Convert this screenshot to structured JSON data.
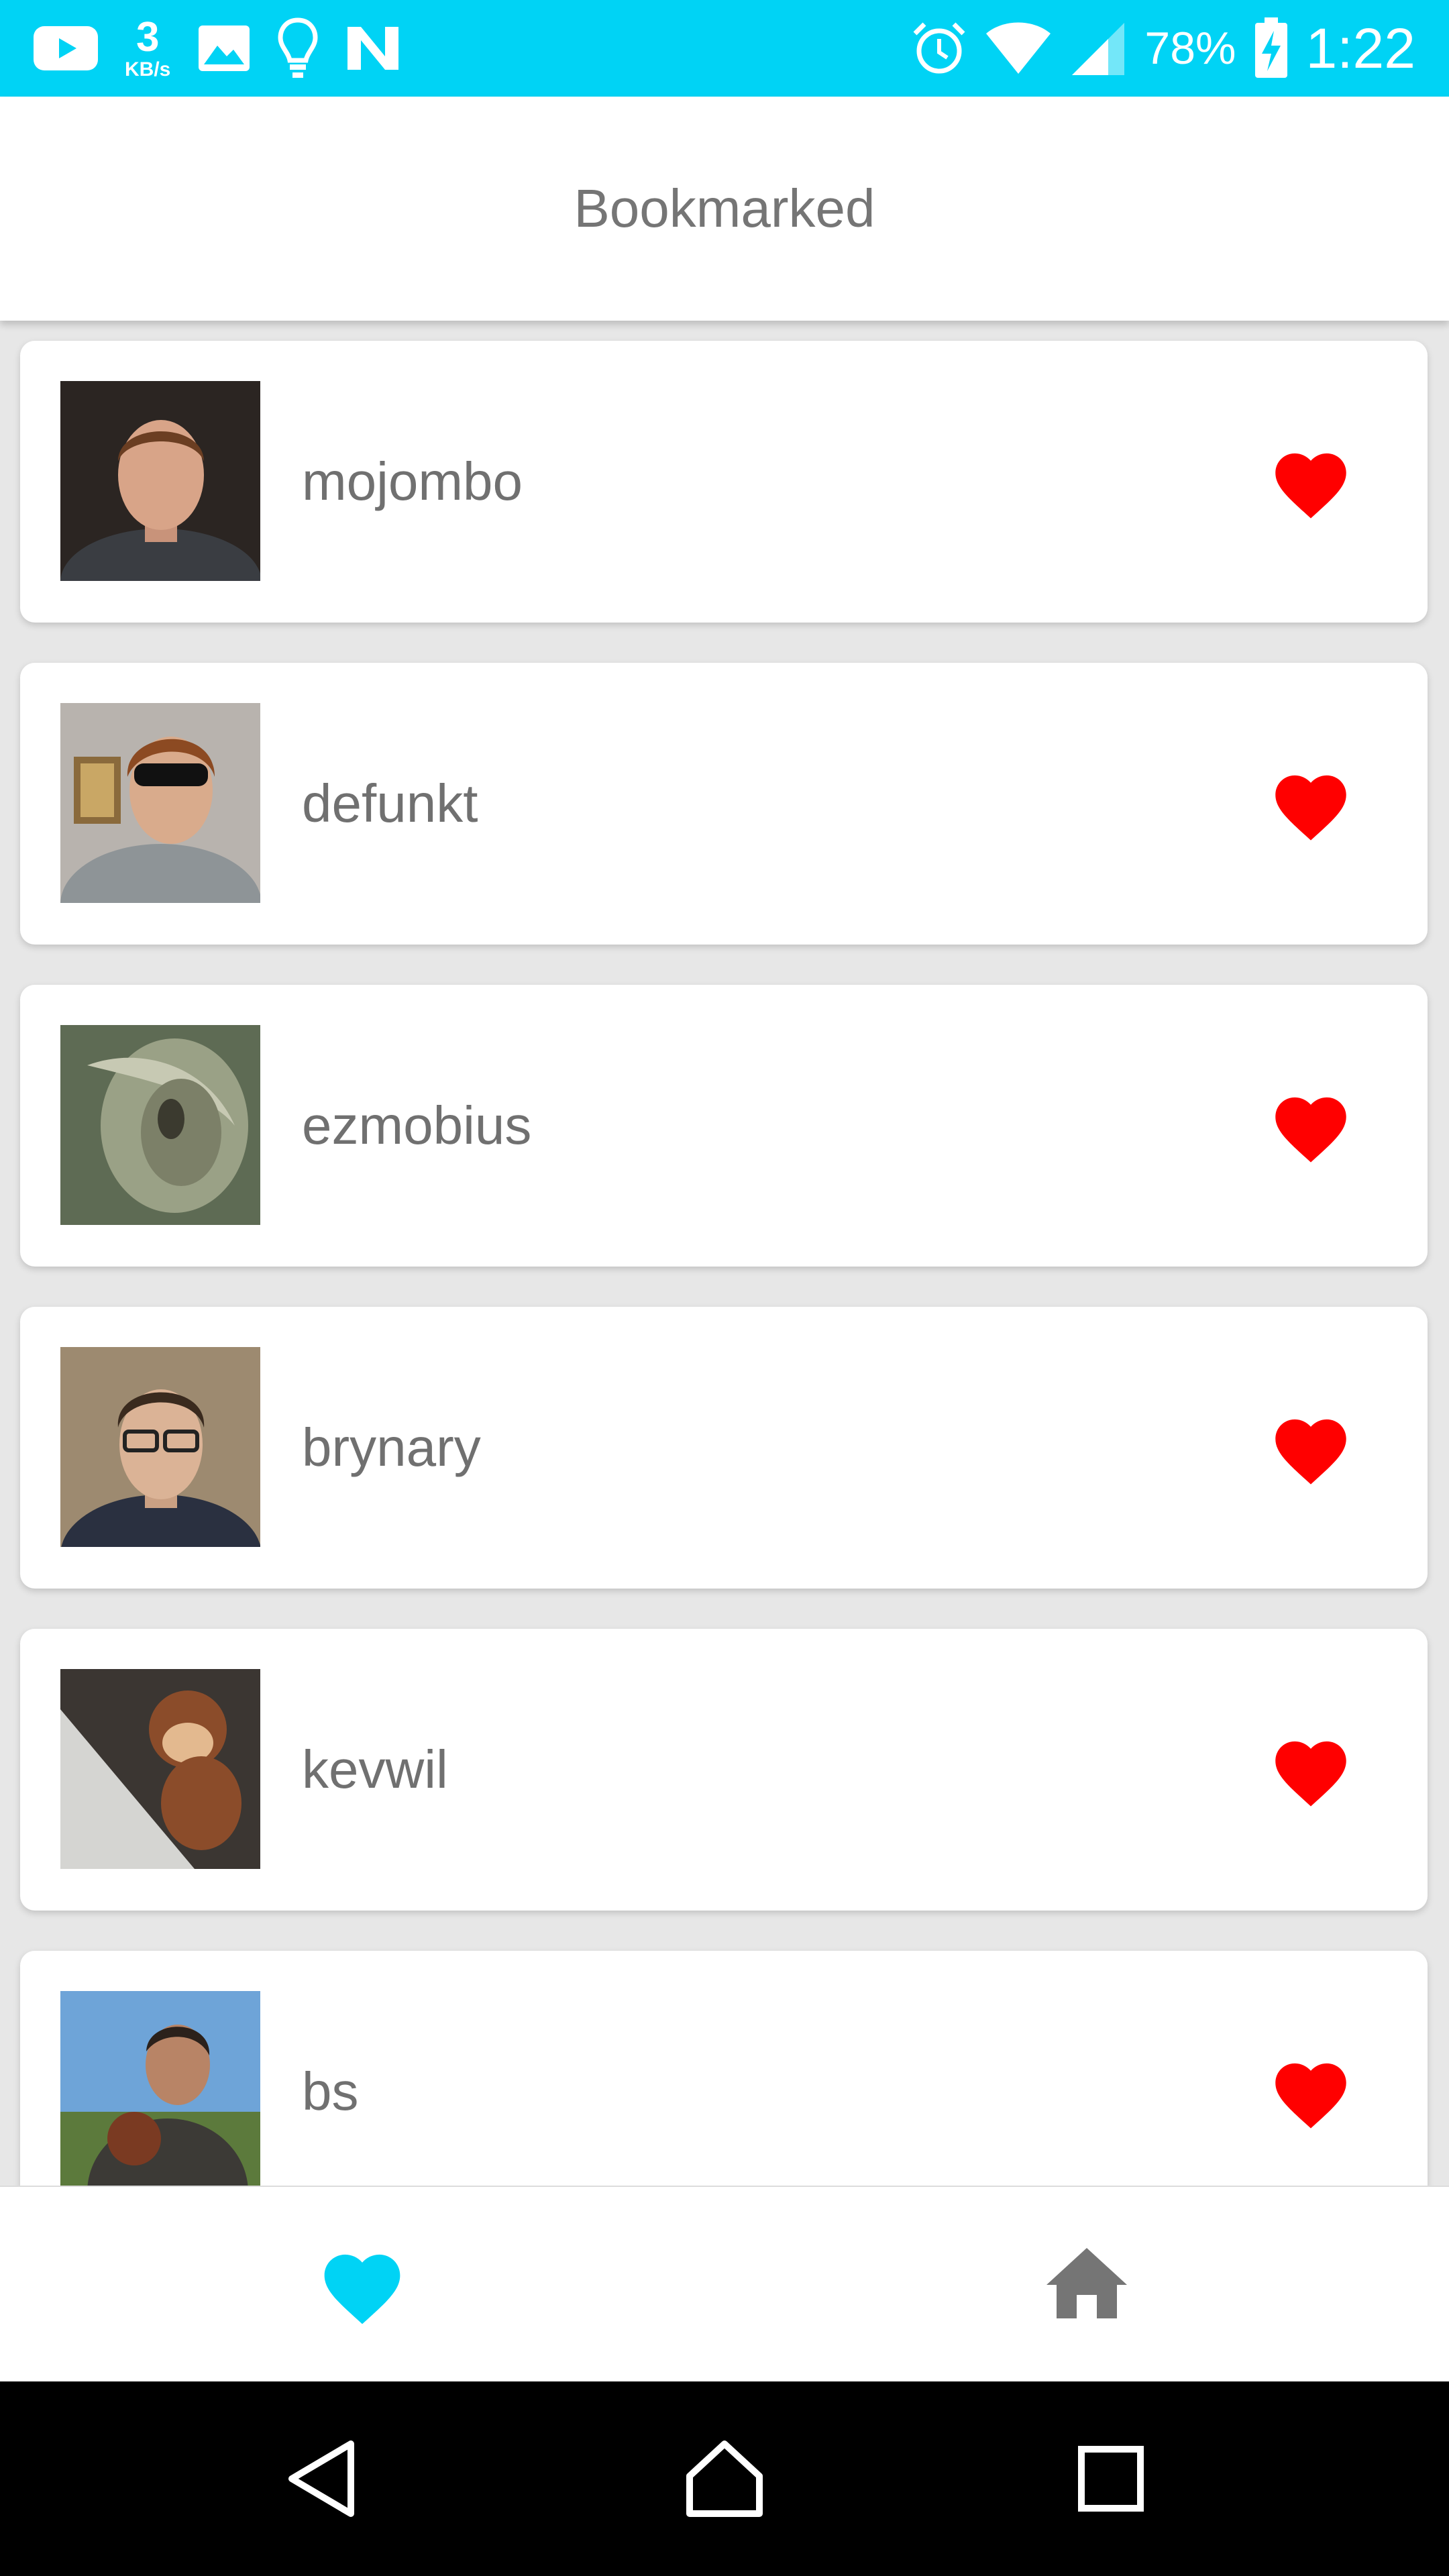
{
  "status_bar": {
    "net_speed_value": "3",
    "net_speed_unit": "KB/s",
    "battery": "78%",
    "time": "1:22",
    "color": "#00d3f5"
  },
  "app_bar": {
    "title": "Bookmarked"
  },
  "users": [
    {
      "name": "mojombo",
      "bookmarked": true
    },
    {
      "name": "defunkt",
      "bookmarked": true
    },
    {
      "name": "ezmobius",
      "bookmarked": true
    },
    {
      "name": "brynary",
      "bookmarked": true
    },
    {
      "name": "kevwil",
      "bookmarked": true
    },
    {
      "name": "bs",
      "bookmarked": true
    }
  ],
  "bottom_nav": {
    "items": [
      {
        "icon": "heart-icon",
        "active": true
      },
      {
        "icon": "home-icon",
        "active": false
      }
    ],
    "active_color": "#00d3f5",
    "inactive_color": "#757575"
  },
  "colors": {
    "bookmark_heart": "#ff0000"
  }
}
